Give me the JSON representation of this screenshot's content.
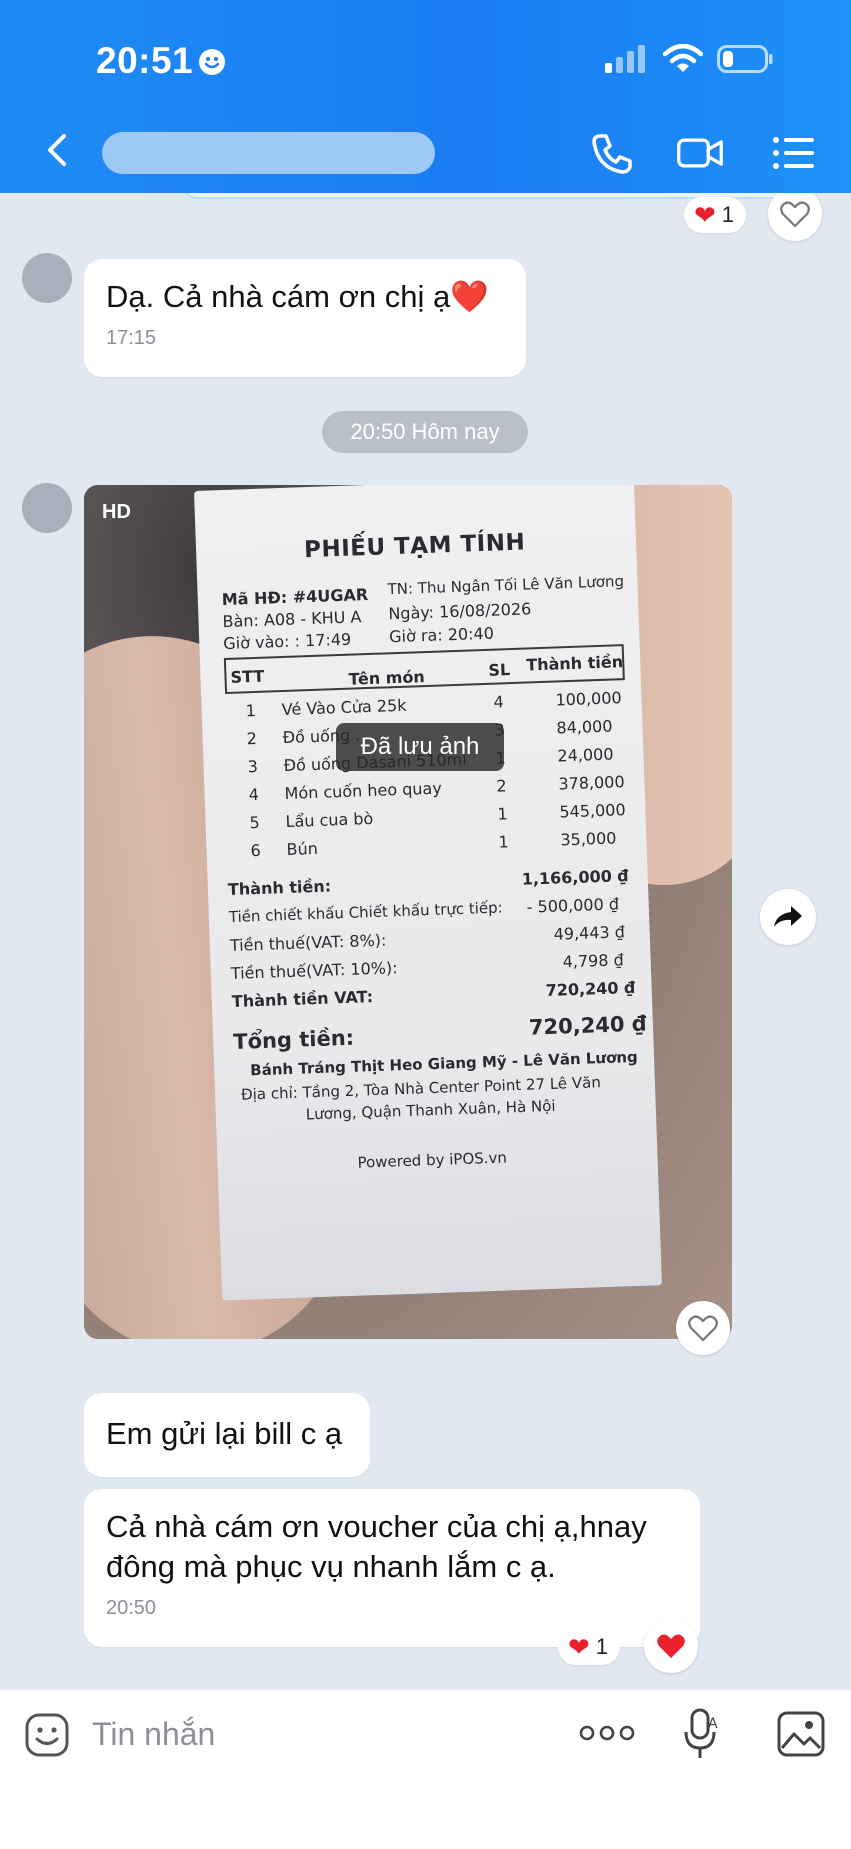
{
  "status_bar": {
    "time": "20:51"
  },
  "header": {
    "contact_name": ""
  },
  "messages": {
    "prev_reaction_count": "1",
    "msg1": {
      "text": "Dạ. Cả nhà cám ơn chị ạ❤️",
      "time": "17:15"
    },
    "date_separator": "20:50 Hôm nay",
    "photo": {
      "hd_label": "HD",
      "saved_toast": "Đã lưu ảnh",
      "receipt": {
        "title": "PHIẾU TẠM TÍNH",
        "invoice": "Mã HĐ: #4UGAR",
        "cashier": "TN: Thu Ngân Tối Lê Văn Lương",
        "table": "Bàn: A08 - KHU A",
        "date": "Ngày: 16/08/2026",
        "time_in": "Giờ vào: : 17:49",
        "time_out": "Giờ ra: 20:40",
        "col_stt": "STT",
        "col_name": "Tên món",
        "col_qty": "SL",
        "col_total": "Thành tiền",
        "items": [
          {
            "stt": "1",
            "name": "Vé Vào Cửa 25k",
            "qty": "4",
            "total": "100,000"
          },
          {
            "stt": "2",
            "name": "Đồ uống ...",
            "qty": "3",
            "total": "84,000"
          },
          {
            "stt": "3",
            "name": "Đồ uống Dasani 510ml",
            "qty": "1",
            "total": "24,000"
          },
          {
            "stt": "4",
            "name": "Món cuốn heo quay",
            "qty": "2",
            "total": "378,000"
          },
          {
            "stt": "5",
            "name": "Lẩu cua bò",
            "qty": "1",
            "total": "545,000"
          },
          {
            "stt": "6",
            "name": "Bún",
            "qty": "1",
            "total": "35,000"
          }
        ],
        "subtotal_label": "Thành tiền:",
        "subtotal": "1,166,000 ₫",
        "discount_label": "Tiền chiết khấu Chiết khấu trực tiếp:",
        "discount": "- 500,000 ₫",
        "vat8_label": "Tiền thuế(VAT: 8%):",
        "vat8": "49,443 ₫",
        "vat10_label": "Tiền thuế(VAT: 10%):",
        "vat10": "4,798 ₫",
        "vat_total_label": "Thành tiền VAT:",
        "vat_total": "720,240 ₫",
        "grand_total_label": "Tổng tiền:",
        "grand_total": "720,240 ₫",
        "store": "Bánh Tráng Thịt Heo Giang Mỹ - Lê Văn Lương",
        "address1": "Địa chỉ: Tầng 2, Tòa Nhà Center Point 27 Lê Văn",
        "address2": "Lương, Quận Thanh Xuân, Hà Nội",
        "powered": "Powered by iPOS.vn"
      }
    },
    "msg2": {
      "text": "Em gửi lại bill c ạ"
    },
    "msg3": {
      "line1": "Cả nhà cám ơn voucher của chị ạ,hnay",
      "line2": "đông mà phục vụ nhanh lắm c ạ.",
      "time": "20:50"
    },
    "last_reaction_count": "1"
  },
  "composer": {
    "placeholder": "Tin nhắn"
  },
  "colors": {
    "header_blue": "#1a7df2",
    "heart_red": "#e8202a",
    "chat_bg": "#e2e8f0"
  }
}
